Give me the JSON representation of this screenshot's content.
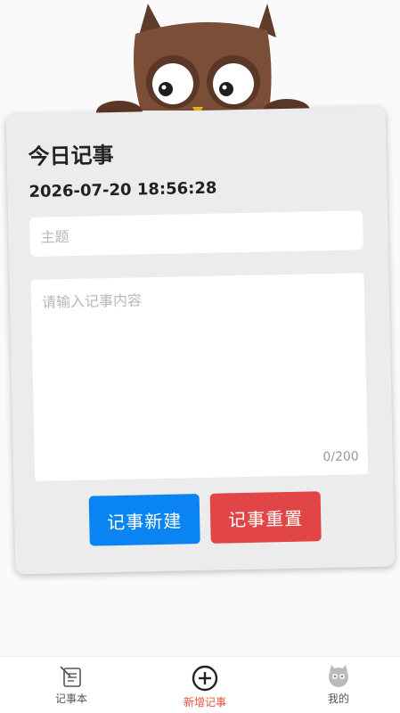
{
  "card": {
    "title": "今日记事",
    "datetime": "2026-07-20 18:56:28",
    "subject_placeholder": "主题",
    "content_placeholder": "请输入记事内容",
    "counter": "0/200"
  },
  "buttons": {
    "new_label": "记事新建",
    "reset_label": "记事重置"
  },
  "tabbar": {
    "items": [
      {
        "label": "记事本",
        "icon": "notebook-icon"
      },
      {
        "label": "新增记事",
        "icon": "plus-circle-icon",
        "active": true
      },
      {
        "label": "我的",
        "icon": "profile-icon"
      }
    ]
  },
  "colors": {
    "primary": "#0a84f2",
    "danger": "#e24545",
    "active_tab": "#e8503a",
    "card_bg": "#ececec"
  }
}
